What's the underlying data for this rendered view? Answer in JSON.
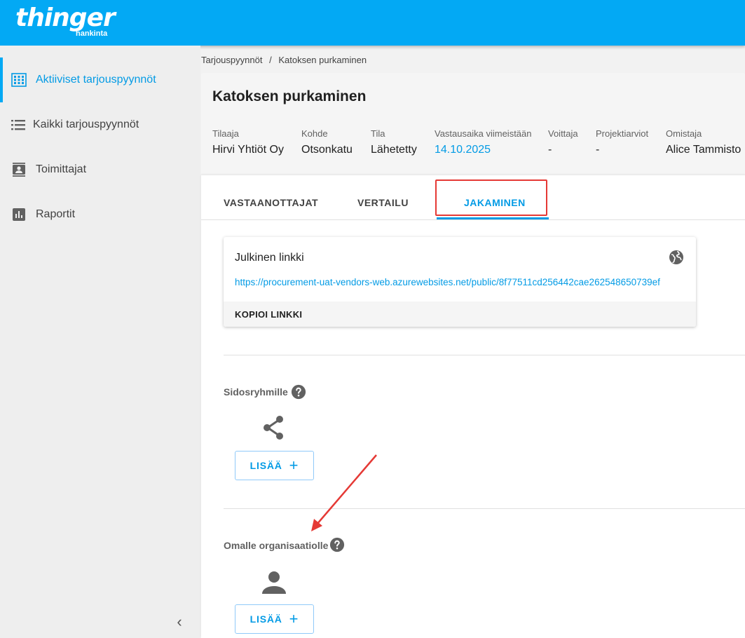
{
  "app": {
    "logo": "thinger",
    "logo_sub": "hankinta"
  },
  "sidebar": {
    "items": [
      {
        "label": "Aktiiviset tarjouspyynnöt",
        "icon": "grid-view-icon",
        "active": true
      },
      {
        "label": "Kaikki tarjouspyynnöt",
        "icon": "list-icon",
        "active": false
      },
      {
        "label": "Toimittajat",
        "icon": "contact-card-icon",
        "active": false
      },
      {
        "label": "Raportit",
        "icon": "bar-chart-icon",
        "active": false
      }
    ],
    "collapse_icon": "chevron-left-icon"
  },
  "breadcrumb": {
    "root": "Tarjouspyynnöt",
    "separator": "/",
    "current": "Katoksen purkaminen"
  },
  "header": {
    "title": "Katoksen purkaminen",
    "fields": [
      {
        "label": "Tilaaja",
        "value": "Hirvi Yhtiöt Oy"
      },
      {
        "label": "Kohde",
        "value": "Otsonkatu"
      },
      {
        "label": "Tila",
        "value": "Lähetetty"
      },
      {
        "label": "Vastausaika viimeistään",
        "value": "14.10.2025"
      },
      {
        "label": "Voittaja",
        "value": "-"
      },
      {
        "label": "Projektiarviot",
        "value": "-"
      },
      {
        "label": "Omistaja",
        "value": "Alice Tammisto"
      }
    ]
  },
  "tabs": [
    {
      "label": "VASTAANOTTAJAT",
      "active": false
    },
    {
      "label": "VERTAILU",
      "active": false
    },
    {
      "label": "JAKAMINEN",
      "active": true
    }
  ],
  "public_link": {
    "title": "Julkinen linkki",
    "url": "https://procurement-uat-vendors-web.azurewebsites.net/public/8f77511cd256442cae262548650739ef",
    "copy_label": "KOPIOI LINKKI",
    "icon": "globe-icon"
  },
  "sections": [
    {
      "title": "Sidosryhmille",
      "icon": "share-icon",
      "add_label": "LISÄÄ"
    },
    {
      "title": "Omalle organisaatiolle",
      "icon": "person-icon",
      "add_label": "LISÄÄ"
    }
  ],
  "colors": {
    "primary": "#03a9f4",
    "link": "#039be5",
    "annotation": "#e53935"
  }
}
